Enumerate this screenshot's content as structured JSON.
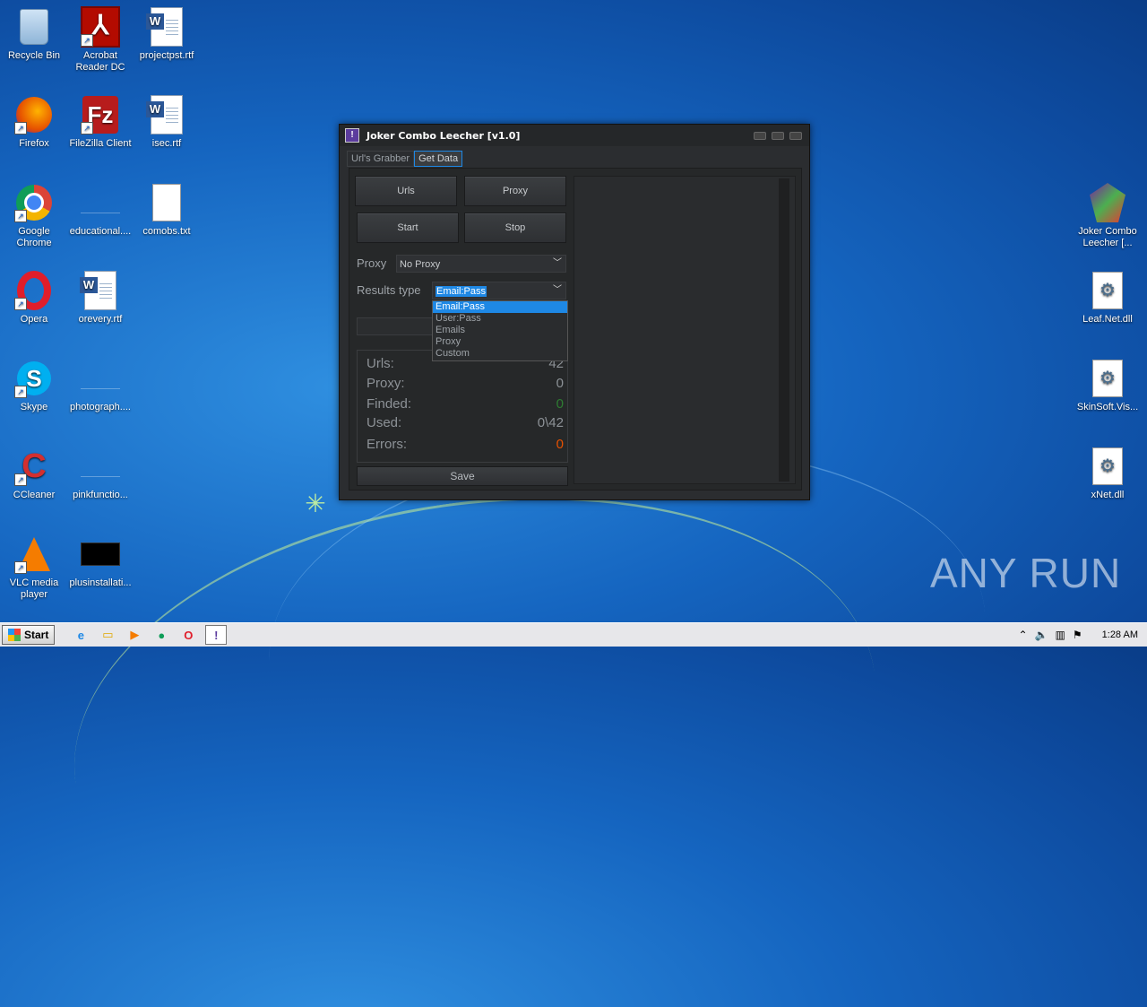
{
  "desktop": {
    "icons_left": [
      {
        "label": "Recycle Bin",
        "icon": "recycle-bin-icon"
      },
      {
        "label": "Acrobat Reader DC",
        "icon": "acrobat-icon"
      },
      {
        "label": "projectpst.rtf",
        "icon": "word-doc-icon"
      },
      {
        "label": "Firefox",
        "icon": "firefox-icon"
      },
      {
        "label": "FileZilla Client",
        "icon": "filezilla-icon"
      },
      {
        "label": "isec.rtf",
        "icon": "word-doc-icon"
      },
      {
        "label": "Google Chrome",
        "icon": "chrome-icon"
      },
      {
        "label": "educational....",
        "icon": "blank-file-icon"
      },
      {
        "label": "comobs.txt",
        "icon": "text-file-icon"
      },
      {
        "label": "Opera",
        "icon": "opera-icon"
      },
      {
        "label": "orevery.rtf",
        "icon": "word-doc-icon"
      },
      {
        "label": "Skype",
        "icon": "skype-icon"
      },
      {
        "label": "photograph....",
        "icon": "blank-file-icon"
      },
      {
        "label": "CCleaner",
        "icon": "ccleaner-icon"
      },
      {
        "label": "pinkfunctio...",
        "icon": "blank-file-icon"
      },
      {
        "label": "VLC media player",
        "icon": "vlc-icon"
      },
      {
        "label": "plusinstallati...",
        "icon": "black-file-icon"
      }
    ],
    "icons_right": [
      {
        "label": "Joker Combo Leecher [...",
        "icon": "joker-icon"
      },
      {
        "label": "Leaf.Net.dll",
        "icon": "dll-icon"
      },
      {
        "label": "SkinSoft.Vis...",
        "icon": "dll-icon"
      },
      {
        "label": "xNet.dll",
        "icon": "dll-icon"
      }
    ],
    "watermark": "ANY RUN"
  },
  "window": {
    "title": "Joker Combo Leecher [v1.0]",
    "tabs": [
      "Url's Grabber",
      "Get Data"
    ],
    "active_tab": "Get Data",
    "buttons": {
      "urls": "Urls",
      "proxy": "Proxy",
      "start": "Start",
      "stop": "Stop",
      "save": "Save"
    },
    "proxy_label": "Proxy",
    "proxy_value": "No Proxy",
    "results_type_label": "Results type",
    "results_type_value": "Email:Pass",
    "results_type_options": [
      "Email:Pass",
      "User:Pass",
      "Emails",
      "Proxy",
      "Custom"
    ],
    "stats": {
      "urls_label": "Urls:",
      "urls_value": "42",
      "proxy_label": "Proxy:",
      "proxy_value": "0",
      "finded_label": "Finded:",
      "finded_value": "0",
      "used_label": "Used:",
      "used_value": "0\\42",
      "errors_label": "Errors:",
      "errors_value": "0"
    },
    "colors": {
      "finded": "#2e7d32",
      "errors": "#e65100",
      "accent": "#1e88e5"
    }
  },
  "taskbar": {
    "start_label": "Start",
    "clock": "1:28 AM"
  }
}
